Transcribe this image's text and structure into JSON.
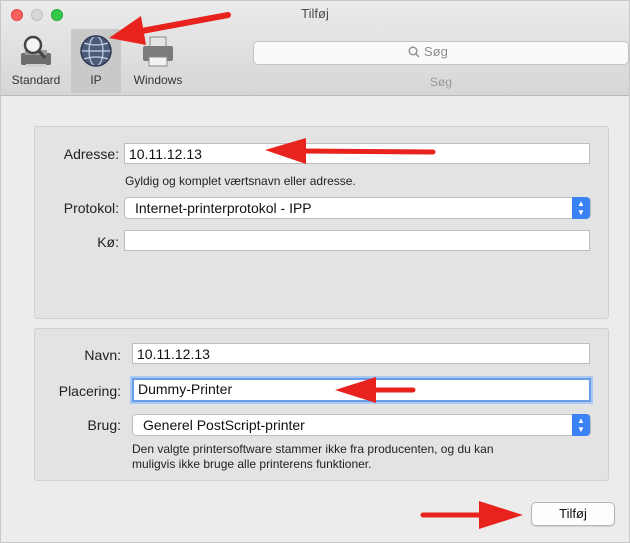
{
  "window": {
    "title": "Tilføj"
  },
  "toolbar": {
    "buttons": [
      {
        "label": "Standard",
        "icon": "magnifier-printer-icon"
      },
      {
        "label": "IP",
        "icon": "globe-icon",
        "selected": true
      },
      {
        "label": "Windows",
        "icon": "printer-icon"
      }
    ],
    "search": {
      "placeholder": "Søg",
      "label": "Søg"
    }
  },
  "form": {
    "address": {
      "label": "Adresse:",
      "value": "10.11.12.13",
      "hint": "Gyldig og komplet værtsnavn eller adresse."
    },
    "protocol": {
      "label": "Protokol:",
      "value": "Internet-printerprotokol - IPP"
    },
    "queue": {
      "label": "Kø:",
      "value": ""
    },
    "name": {
      "label": "Navn:",
      "value": "10.11.12.13"
    },
    "location": {
      "label": "Placering:",
      "value": "Dummy-Printer"
    },
    "use": {
      "label": "Brug:",
      "value": "Generel PostScript-printer",
      "note_line1": "Den valgte printersoftware stammer ikke fra producenten, og du kan",
      "note_line2": "muligvis ikke bruge alle printerens funktioner."
    }
  },
  "add_button": {
    "label": "Tilføj"
  },
  "colors": {
    "annotation_arrow": "#e8231d",
    "select_accent": "#3b82f6"
  }
}
